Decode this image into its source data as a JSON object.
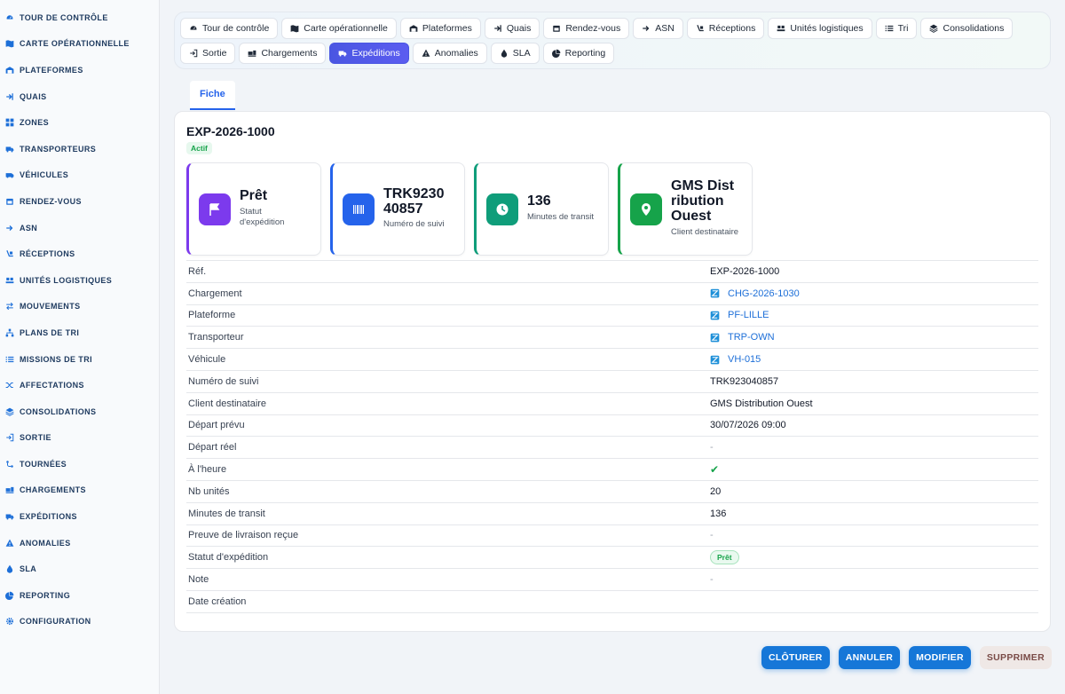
{
  "sidebar": {
    "items": [
      {
        "label": "TOUR DE CONTRÔLE",
        "icon": "gauge-icon"
      },
      {
        "label": "CARTE OPÉRATIONNELLE",
        "icon": "map-icon"
      },
      {
        "label": "PLATEFORMES",
        "icon": "warehouse-icon"
      },
      {
        "label": "QUAIS",
        "icon": "dock-icon"
      },
      {
        "label": "ZONES",
        "icon": "grid-icon"
      },
      {
        "label": "TRANSPORTEURS",
        "icon": "truck-icon"
      },
      {
        "label": "VÉHICULES",
        "icon": "van-icon"
      },
      {
        "label": "RENDEZ-VOUS",
        "icon": "calendar-icon"
      },
      {
        "label": "ASN",
        "icon": "asn-icon"
      },
      {
        "label": "RÉCEPTIONS",
        "icon": "receive-icon"
      },
      {
        "label": "UNITÉS LOGISTIQUES",
        "icon": "pallet-icon"
      },
      {
        "label": "MOUVEMENTS",
        "icon": "arrows-icon"
      },
      {
        "label": "PLANS DE TRI",
        "icon": "sitemap-icon"
      },
      {
        "label": "MISSIONS DE TRI",
        "icon": "list-icon"
      },
      {
        "label": "AFFECTATIONS",
        "icon": "shuffle-icon"
      },
      {
        "label": "CONSOLIDATIONS",
        "icon": "layers-icon"
      },
      {
        "label": "SORTIE",
        "icon": "exit-icon"
      },
      {
        "label": "TOURNÉES",
        "icon": "route-icon"
      },
      {
        "label": "CHARGEMENTS",
        "icon": "loading-icon"
      },
      {
        "label": "EXPÉDITIONS",
        "icon": "shipping-icon"
      },
      {
        "label": "ANOMALIES",
        "icon": "warning-icon"
      },
      {
        "label": "SLA",
        "icon": "drop-icon"
      },
      {
        "label": "REPORTING",
        "icon": "pie-icon"
      },
      {
        "label": "CONFIGURATION",
        "icon": "gear-icon"
      }
    ]
  },
  "tabs": {
    "row1": [
      "Tour de contrôle",
      "Carte opérationnelle",
      "Plateformes",
      "Quais",
      "Rendez-vous",
      "ASN",
      "Réceptions",
      "Unités logistiques",
      "Tri",
      "Consolidations"
    ],
    "row2": [
      "Sortie",
      "Chargements",
      "Expéditions",
      "Anomalies",
      "SLA",
      "Reporting"
    ],
    "active": "Expéditions"
  },
  "subtab": "Fiche",
  "record": {
    "title": "EXP-2026-1000",
    "status_badge": "Actif"
  },
  "kpis": [
    {
      "value": "Prêt",
      "label": "Statut d'expédition",
      "color": "#7c3aed",
      "icon": "flag-icon"
    },
    {
      "value": "TRK923040857",
      "label": "Numéro de suivi",
      "color": "#2563eb",
      "icon": "barcode-icon"
    },
    {
      "value": "136",
      "label": "Minutes de transit",
      "color": "#0f9d7a",
      "icon": "clock-icon"
    },
    {
      "value": "GMS Distribution Ouest",
      "label": "Client destinataire",
      "color": "#16a34a",
      "icon": "location-pin-icon"
    }
  ],
  "details": [
    {
      "label": "Réf.",
      "value": "EXP-2026-1000",
      "type": "text"
    },
    {
      "label": "Chargement",
      "value": "CHG-2026-1030",
      "type": "link"
    },
    {
      "label": "Plateforme",
      "value": "PF-LILLE",
      "type": "link"
    },
    {
      "label": "Transporteur",
      "value": "TRP-OWN",
      "type": "link"
    },
    {
      "label": "Véhicule",
      "value": "VH-015",
      "type": "link"
    },
    {
      "label": "Numéro de suivi",
      "value": "TRK923040857",
      "type": "text"
    },
    {
      "label": "Client destinataire",
      "value": "GMS Distribution Ouest",
      "type": "text"
    },
    {
      "label": "Départ prévu",
      "value": "30/07/2026 09:00",
      "type": "text"
    },
    {
      "label": "Départ réel",
      "value": "-",
      "type": "dash"
    },
    {
      "label": "À l'heure",
      "value": "✔",
      "type": "check"
    },
    {
      "label": "Nb unités",
      "value": "20",
      "type": "text"
    },
    {
      "label": "Minutes de transit",
      "value": "136",
      "type": "text"
    },
    {
      "label": "Preuve de livraison reçue",
      "value": "-",
      "type": "dash"
    },
    {
      "label": "Statut d'expédition",
      "value": "Prêt",
      "type": "pill"
    },
    {
      "label": "Note",
      "value": "-",
      "type": "dash"
    },
    {
      "label": "Date création",
      "value": "",
      "type": "text"
    }
  ],
  "actions": {
    "close": "CLÔTURER",
    "cancel": "ANNULER",
    "edit": "MODIFIER",
    "delete": "SUPPRIMER"
  }
}
